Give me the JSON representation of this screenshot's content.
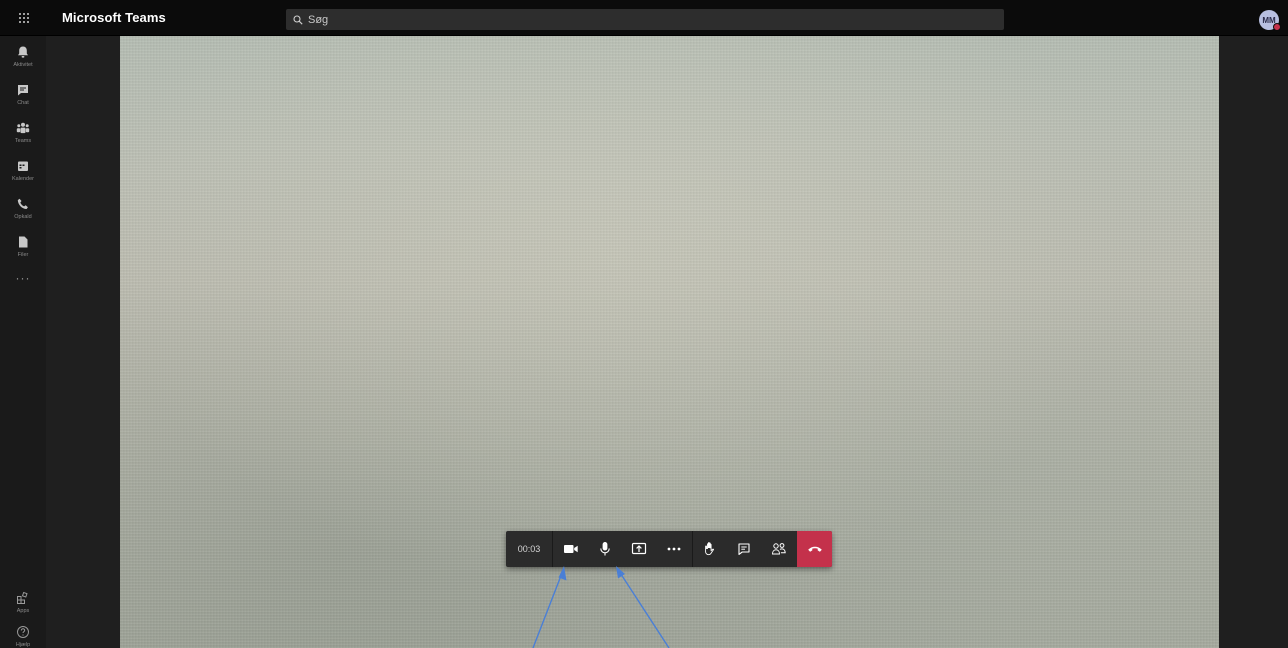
{
  "app": {
    "title": "Microsoft Teams",
    "search_placeholder": "Søg",
    "avatar_initials": "MM"
  },
  "rail": {
    "items": [
      {
        "label": "Aktivitet",
        "icon": "bell-icon"
      },
      {
        "label": "Chat",
        "icon": "chat-icon"
      },
      {
        "label": "Teams",
        "icon": "teams-icon"
      },
      {
        "label": "Kalender",
        "icon": "calendar-icon"
      },
      {
        "label": "Opkald",
        "icon": "phone-icon"
      },
      {
        "label": "Filer",
        "icon": "file-icon"
      }
    ],
    "more": "···",
    "bottom": [
      {
        "label": "Apps",
        "icon": "apps-icon"
      },
      {
        "label": "Hjælp",
        "icon": "help-icon"
      }
    ]
  },
  "call": {
    "timer": "00:03",
    "buttons": [
      "camera-icon",
      "microphone-icon",
      "share-screen-icon",
      "more-options-icon",
      "raise-hand-icon",
      "show-conversation-icon",
      "participants-icon",
      "hang-up-icon"
    ]
  },
  "colors": {
    "hangup": "#c4314b",
    "annotation_arrow": "#4a7fd6",
    "presence": "#c4314b"
  }
}
